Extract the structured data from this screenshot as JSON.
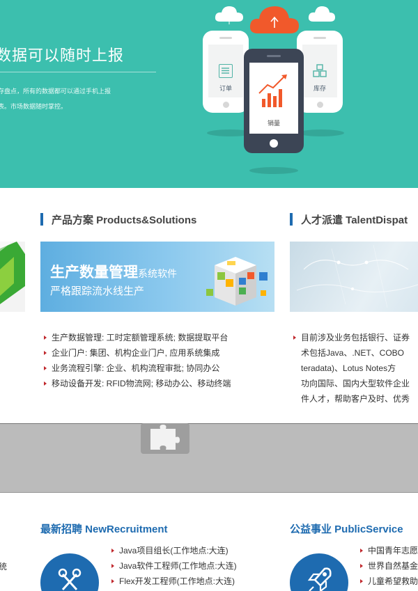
{
  "hero": {
    "title": "数据可以随时上报",
    "desc_line1": "存盘点，所有的数据都可以通过手机上报",
    "desc_line2": "表。市场数据随时掌控。",
    "phone_left_label": "订单",
    "phone_center_label": "销量",
    "phone_right_label": "库存",
    "bg_color": "#3cbfae",
    "cloud_center_color": "#f1592b"
  },
  "products": {
    "title": "产品方案 Products&Solutions",
    "banner_line1_big": "生产数量管理",
    "banner_line1_small": "系统软件",
    "banner_line2": "严格跟踪流水线生产",
    "items": [
      "生产数据管理: 工时定额管理系统; 数据提取平台",
      "企业门户: 集团、机构企业门户, 应用系统集成",
      "业务流程引擎: 企业、机构流程审批; 协同办公",
      "移动设备开发: RFID物流网; 移动办公、移动终端"
    ]
  },
  "talent": {
    "title": "人才派遣 TalentDispat",
    "lines": [
      "目前涉及业务包括银行、证券",
      "术包括Java、.NET、COBO",
      "teradata)、Lotus Notes方",
      "功向国际、国内大型软件企业",
      "件人才，帮助客户及时、优秀"
    ]
  },
  "recruitment": {
    "title": "最新招聘 NewRecruitment",
    "side_text": "统",
    "items": [
      "Java项目组长(工作地点:大连)",
      "Java软件工程师(工作地点:大连)",
      "Flex开发工程师(工作地点:大连)"
    ]
  },
  "public_service": {
    "title": "公益事业 PublicService",
    "items": [
      "中国青年志愿",
      "世界自然基金",
      "儿童希望救助"
    ]
  },
  "colors": {
    "accent_blue": "#1e6bb0",
    "bullet_red": "#c0282d",
    "gray_band": "#bbbbbb"
  }
}
